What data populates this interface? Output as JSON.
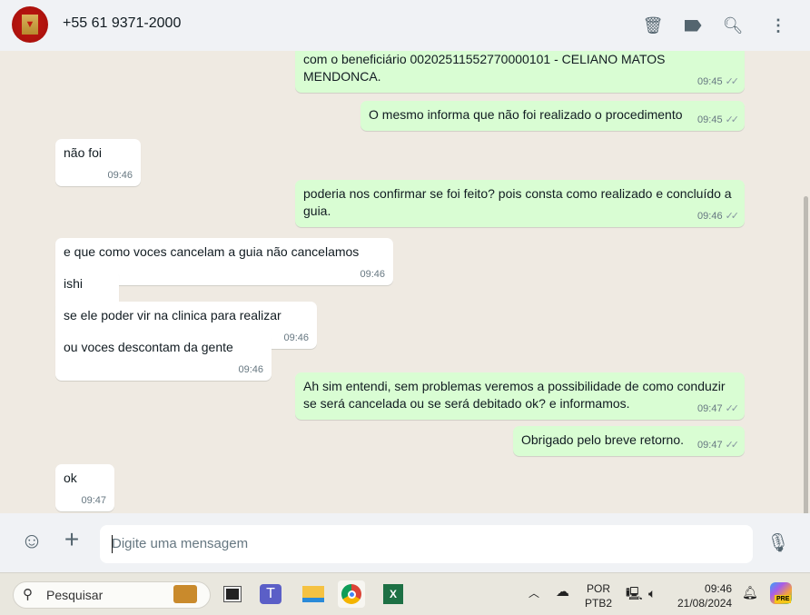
{
  "header": {
    "contact": "+55 61 9371-2000",
    "icons": [
      "archive-icon",
      "label-icon",
      "search-icon",
      "menu-icon"
    ]
  },
  "messages": [
    {
      "dir": "out",
      "text": "com o beneficiário 00202511552770000101 - CELIANO MATOS MENDONCA.",
      "time": "09:45"
    },
    {
      "dir": "out",
      "text": "O mesmo informa que não foi realizado o procedimento",
      "time": "09:45"
    },
    {
      "dir": "in",
      "text": "não foi",
      "time": "09:46"
    },
    {
      "dir": "out",
      "text": "poderia nos confirmar se foi feito? pois consta como realizado e concluído a guia.",
      "time": "09:46"
    },
    {
      "dir": "in",
      "text": "e que como voces cancelam a guia não cancelamos",
      "time": "09:46"
    },
    {
      "dir": "in",
      "text": "ishi",
      "time": "09:46"
    },
    {
      "dir": "in",
      "text": "se ele poder vir na clinica para realizar",
      "time": "09:46"
    },
    {
      "dir": "in",
      "text": "ou voces descontam da gente",
      "time": "09:46"
    },
    {
      "dir": "out",
      "text": "Ah sim entendi, sem problemas veremos a possibilidade de como conduzir se será cancelada ou se será debitado ok? e informamos.",
      "time": "09:47"
    },
    {
      "dir": "out",
      "text": "Obrigado pelo breve retorno.",
      "time": "09:47"
    },
    {
      "dir": "in",
      "text": "ok",
      "time": "09:47"
    }
  ],
  "composer": {
    "placeholder": "Digite uma mensagem"
  },
  "taskbar": {
    "search": "Pesquisar",
    "lang1": "POR",
    "lang2": "PTB2",
    "time": "09:46",
    "date": "21/08/2024",
    "copilot_badge": "PRE"
  }
}
